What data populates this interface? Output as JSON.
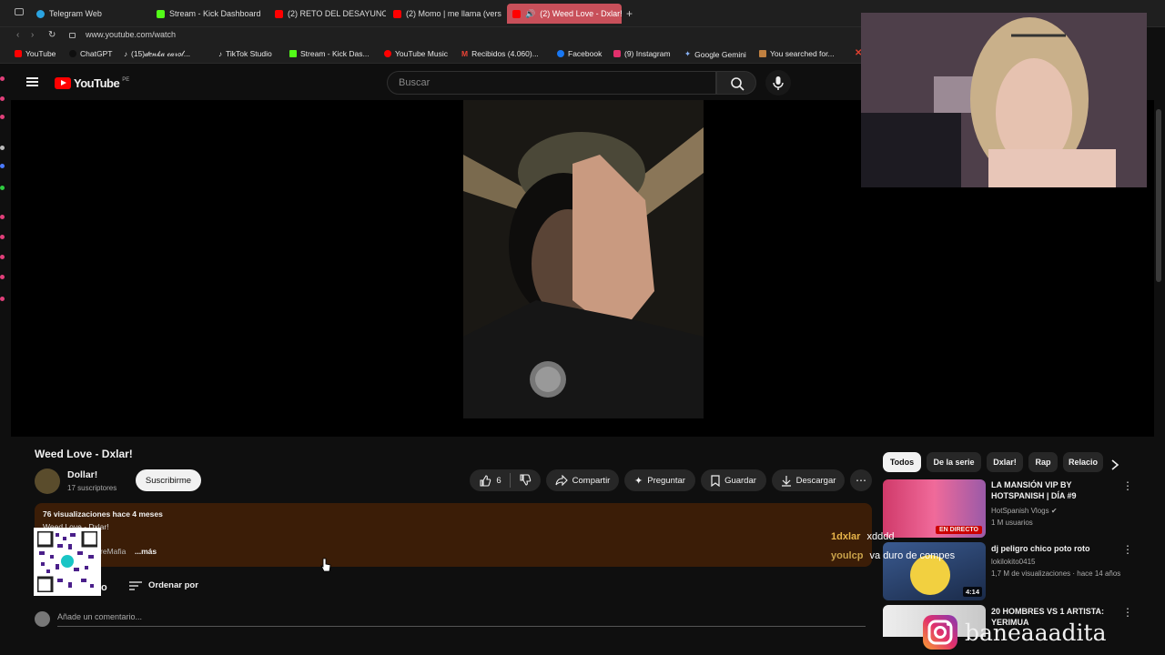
{
  "tabs": [
    {
      "label": "Telegram Web",
      "color": "#2aa3e0"
    },
    {
      "label": "Stream - Kick Dashboard",
      "color": "#53fc18"
    },
    {
      "label": "(2) RETO DEL DESAYUNO",
      "color": "#ff0000"
    },
    {
      "label": "(2) Momo | me llama (vers",
      "color": "#ff0000"
    },
    {
      "label": "(2) Weed Love - Dxlar!",
      "color": "#ff0000"
    }
  ],
  "new_tab": "+",
  "url": "www.youtube.com/watch",
  "bookmarks": [
    {
      "label": "YouTube",
      "color": "#ff0000"
    },
    {
      "label": "ChatGPT",
      "color": "#10a37f"
    },
    {
      "label": "(15)𝒹𝑒𝓃𝓀𝒶 𝒸𝒶𝓇𝑜𝓁...",
      "color": "#ffffff"
    },
    {
      "label": "TikTok Studio",
      "color": "#ffffff"
    },
    {
      "label": "Stream - Kick Das...",
      "color": "#53fc18"
    },
    {
      "label": "YouTube Music",
      "color": "#ff0000"
    },
    {
      "label": "Recibidos (4.060)...",
      "color": "#ea4335"
    },
    {
      "label": "Facebook",
      "color": "#1877f2"
    },
    {
      "label": "(9) Instagram",
      "color": "#e1306c"
    },
    {
      "label": "Google Gemini",
      "color": "#8ab4f8"
    },
    {
      "label": "You searched for...",
      "color": "#c08040"
    }
  ],
  "yt": {
    "logo_text": "YouTube",
    "region": "PE",
    "search_placeholder": "Buscar"
  },
  "video": {
    "title": "Weed Love - Dxlar!",
    "channel": "Dollar!",
    "subscribers": "17 suscriptores",
    "subscribe_label": "Suscribirme",
    "likes": "6",
    "share": "Compartir",
    "ask": "Preguntar",
    "save": "Guardar",
    "download": "Descargar",
    "views": "76 visualizaciones  hace 4 meses",
    "desc_line1": "Weed Love - Dxlar!",
    "desc_line2": "reMafia",
    "more": "...más",
    "sort_label": "Ordenar por",
    "comments_count": "o",
    "comment_placeholder": "Añade un comentario..."
  },
  "chips": [
    "Todos",
    "De la serie",
    "Dxlar!",
    "Rap",
    "Relacio"
  ],
  "recommendations": [
    {
      "title": "LA MANSIÓN VIP BY HOTSPANISH | DÍA #9",
      "channel": "HotSpanish Vlogs ✔",
      "meta": "1 M usuarios",
      "badge": "EN DIRECTO"
    },
    {
      "title": "dj peligro chico poto roto",
      "channel": "lokilokito0415",
      "meta": "1,7 M de visualizaciones · hace 14 años",
      "badge": "4:14"
    },
    {
      "title": "20 HOMBRES VS 1 ARTISTA: YERIMUA",
      "channel": "",
      "meta": "",
      "badge": ""
    }
  ],
  "chat": [
    {
      "user": "1dxlar",
      "msg": "xdddd",
      "color": "#e8b54a"
    },
    {
      "user": "youlcp",
      "msg": "va duro de compes",
      "color": "#c9a24a"
    }
  ],
  "overlay_handle": "baneaaadita",
  "colors": {
    "accent_red": "#ff0000",
    "desc_bg": "#3b1d07",
    "active_tab": "#c8505a"
  }
}
